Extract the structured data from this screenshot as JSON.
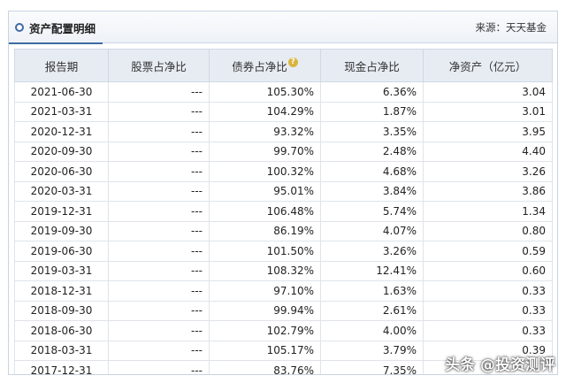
{
  "panel": {
    "title": "资产配置明细",
    "source": "来源：天天基金"
  },
  "table": {
    "headers": [
      "报告期",
      "股票占净比",
      "债券占净比",
      "现金占净比",
      "净资产（亿元）"
    ],
    "help_icon": "?",
    "rows": [
      [
        "2021-06-30",
        "---",
        "105.30%",
        "6.36%",
        "3.04"
      ],
      [
        "2021-03-31",
        "---",
        "104.29%",
        "1.87%",
        "3.01"
      ],
      [
        "2020-12-31",
        "---",
        "93.32%",
        "3.35%",
        "3.95"
      ],
      [
        "2020-09-30",
        "---",
        "99.70%",
        "2.48%",
        "4.40"
      ],
      [
        "2020-06-30",
        "---",
        "100.32%",
        "4.68%",
        "3.26"
      ],
      [
        "2020-03-31",
        "---",
        "95.01%",
        "3.84%",
        "3.86"
      ],
      [
        "2019-12-31",
        "---",
        "106.48%",
        "5.74%",
        "1.34"
      ],
      [
        "2019-09-30",
        "---",
        "86.19%",
        "4.07%",
        "0.80"
      ],
      [
        "2019-06-30",
        "---",
        "101.50%",
        "3.26%",
        "0.59"
      ],
      [
        "2019-03-31",
        "---",
        "108.32%",
        "12.41%",
        "0.60"
      ],
      [
        "2018-12-31",
        "---",
        "97.10%",
        "1.63%",
        "0.33"
      ],
      [
        "2018-09-30",
        "---",
        "99.94%",
        "2.61%",
        "0.33"
      ],
      [
        "2018-06-30",
        "---",
        "102.79%",
        "4.00%",
        "0.33"
      ],
      [
        "2018-03-31",
        "---",
        "105.17%",
        "3.79%",
        "0.39"
      ],
      [
        "2017-12-31",
        "---",
        "83.76%",
        "7.35%",
        ""
      ]
    ]
  },
  "watermark": "头条 @投资测评",
  "colors": {
    "accent": "#3e6aa3",
    "header_bg": "#e7ecf3",
    "border": "#cfd8e4"
  }
}
